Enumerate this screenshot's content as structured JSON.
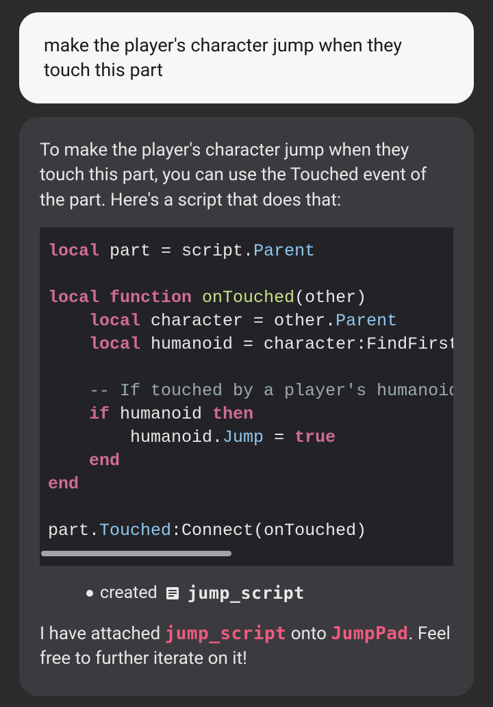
{
  "user": {
    "message": "make the player's character jump when they touch this part"
  },
  "assistant": {
    "intro": "To make the player's character jump when they touch this part, you can use the Touched event of the part. Here's a script that does that:",
    "code": {
      "l1a": "local",
      "l1b": " part = script.",
      "l1c": "Parent",
      "l2a": "local",
      "l2b": " function",
      "l2c": " onTouched",
      "l2d": "(other)",
      "l3a": "    ",
      "l3b": "local",
      "l3c": " character = other.",
      "l3d": "Parent",
      "l4a": "    ",
      "l4b": "local",
      "l4c": " humanoid = character:FindFirstChildOfClass(\"Humanoid\")",
      "l5": "    -- If touched by a player's humanoid",
      "l6a": "    ",
      "l6b": "if",
      "l6c": " humanoid ",
      "l6d": "then",
      "l7a": "        humanoid.",
      "l7b": "Jump",
      "l7c": " = ",
      "l7d": "true",
      "l8": "    end",
      "l9": "end",
      "l10a": "part.",
      "l10b": "Touched",
      "l10c": ":Connect(onTouched)"
    },
    "created": {
      "label": "created",
      "name": "jump_script"
    },
    "outro1a": "I have attached ",
    "outro1b": "jump_script",
    "outro1c": " onto ",
    "outro1d": "JumpPad",
    "outro1e": ". Feel free to further iterate on it!"
  }
}
